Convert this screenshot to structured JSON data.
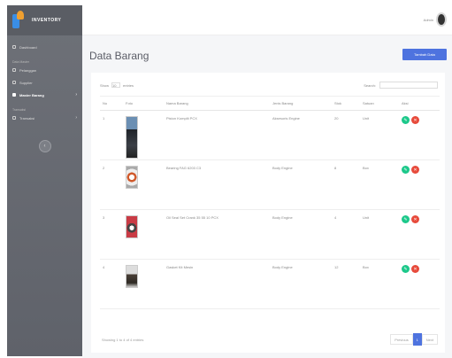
{
  "sidebar": {
    "brand": "INVENTORY",
    "items": [
      {
        "label": "Dashboard",
        "type": "item"
      },
      {
        "label": "Data Master",
        "type": "heading"
      },
      {
        "label": "Pelanggan",
        "type": "item"
      },
      {
        "label": "Supplier",
        "type": "item"
      },
      {
        "label": "Master Barang",
        "type": "item",
        "active": true
      },
      {
        "label": "Transaksi",
        "type": "heading"
      },
      {
        "label": "Transaksi",
        "type": "item"
      }
    ],
    "toggle_icon": "chevron-left-icon"
  },
  "topbar": {
    "username": "Admin"
  },
  "main": {
    "title": "Data Barang",
    "add_button": "Tambah Data",
    "controls": {
      "show": "Show",
      "entries_value": "10",
      "entries": "entries",
      "search": "Search:"
    },
    "table": {
      "headers": [
        "No",
        "Foto",
        "Nama Barang",
        "Jenis Barang",
        "Stok",
        "Satuan",
        "Aksi"
      ],
      "rows": [
        {
          "no": "1",
          "nama": "Piston Komplit PCX",
          "jenis": "Aksesoris Engine",
          "stok": "20",
          "satuan": "Unit"
        },
        {
          "no": "2",
          "nama": "Bearing FAG 6203 C3",
          "jenis": "Body Engine",
          "stok": "8",
          "satuan": "Box"
        },
        {
          "no": "3",
          "nama": "Oil Seal Set Crank 35 55 10 PCX",
          "jenis": "Body Engine",
          "stok": "4",
          "satuan": "Unit"
        },
        {
          "no": "4",
          "nama": "Gasket Kit Mesin",
          "jenis": "Body Engine",
          "stok": "12",
          "satuan": "Box"
        }
      ]
    },
    "footer_info": "Showing 1 to 4 of 4 entries",
    "pager": {
      "prev": "Previous",
      "current": "1",
      "next": "Next"
    }
  },
  "colors": {
    "primary": "#4e73df",
    "success": "#1cc88a",
    "danger": "#e74a3b",
    "sidebar": "#64676e"
  }
}
